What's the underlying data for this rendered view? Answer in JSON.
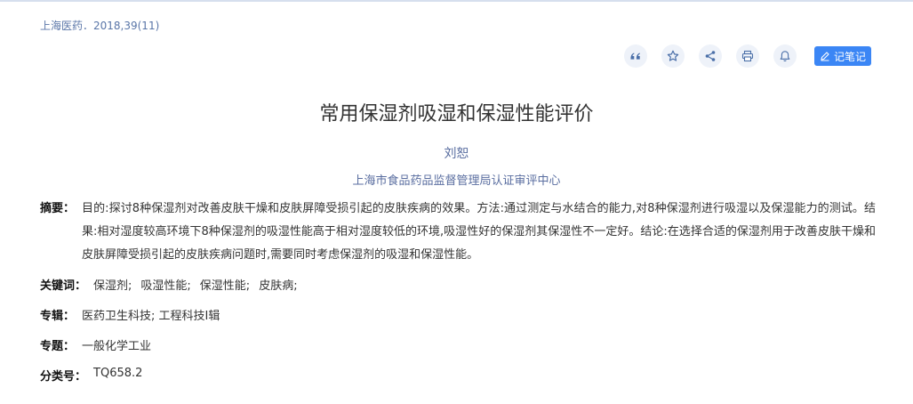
{
  "source": "上海医药．2018,39(11)",
  "toolbar": {
    "note_label": "记笔记",
    "icons": [
      "quote-icon",
      "star-icon",
      "share-icon",
      "print-icon",
      "bell-icon",
      "pencil-icon"
    ],
    "accent_color": "#3b86f5"
  },
  "article": {
    "title": "常用保湿剂吸湿和保湿性能评价",
    "author": "刘恕",
    "organization": "上海市食品药品监督管理局认证审评中心"
  },
  "abstract": {
    "label": "摘要：",
    "text": "目的:探讨8种保湿剂对改善皮肤干燥和皮肤屏障受损引起的皮肤疾病的效果。方法:通过测定与水结合的能力,对8种保湿剂进行吸湿以及保湿能力的测试。结果:相对湿度较高环境下8种保湿剂的吸湿性能高于相对湿度较低的环境,吸湿性好的保湿剂其保湿性不一定好。结论:在选择合适的保湿剂用于改善皮肤干燥和皮肤屏障受损引起的皮肤疾病问题时,需要同时考虑保湿剂的吸湿和保湿性能。"
  },
  "meta": {
    "keywords_label": "关键词：",
    "keywords": [
      "保湿剂;",
      "吸湿性能;",
      "保湿性能;",
      "皮肤病;"
    ],
    "series_label": "专辑：",
    "series_value": "医药卫生科技; 工程科技Ⅰ辑",
    "topic_label": "专题：",
    "topic_value": "一般化学工业",
    "class_label": "分类号：",
    "class_value": "TQ658.2"
  }
}
